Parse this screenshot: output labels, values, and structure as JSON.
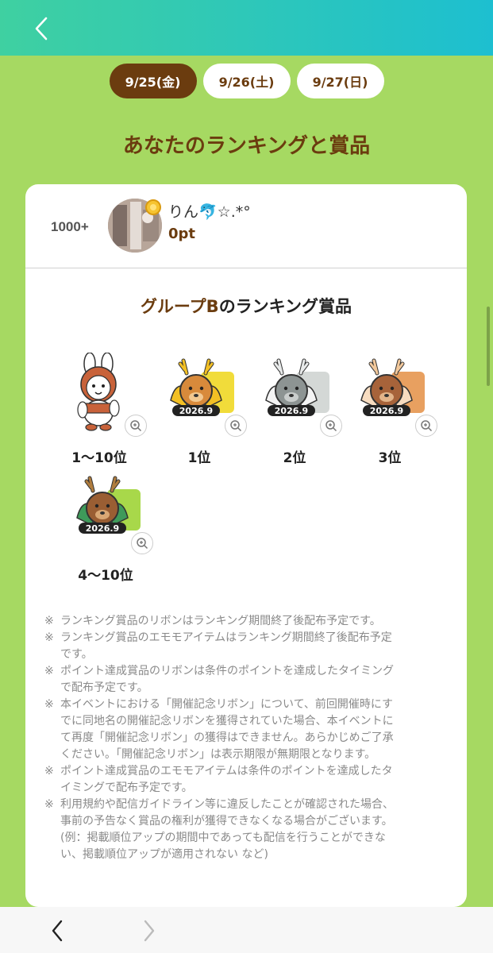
{
  "tabs": [
    {
      "label": "9/25(金)",
      "active": true
    },
    {
      "label": "9/26(土)",
      "active": false
    },
    {
      "label": "9/27(日)",
      "active": false
    }
  ],
  "section_title": "あなたのランキングと賞品",
  "user": {
    "rank": "1000+",
    "name": "りん🐬☆.*°",
    "points": "0pt"
  },
  "group_title_prefix": "グループB",
  "group_title_suffix": "のランキング賞品",
  "prizes": [
    {
      "label": "1〜10位",
      "item": "bunny-costume-character",
      "badge_text": ""
    },
    {
      "label": "1位",
      "item": "gold-reindeer-ribbon",
      "badge_text": "2026.9"
    },
    {
      "label": "2位",
      "item": "silver-reindeer-ribbon",
      "badge_text": "2026.9"
    },
    {
      "label": "3位",
      "item": "bronze-reindeer-ribbon",
      "badge_text": "2026.9"
    },
    {
      "label": "4〜10位",
      "item": "green-reindeer-ribbon",
      "badge_text": "2026.9"
    }
  ],
  "notes_mark": "※",
  "notes": [
    [
      "ランキング賞品のリボンはランキング期間終了後配布予定です。"
    ],
    [
      "ランキング賞品のエモモアイテムはランキング期間終了後配布予定",
      "です。"
    ],
    [
      "ポイント達成賞品のリボンは条件のポイントを達成したタイミング",
      "で配布予定です。"
    ],
    [
      "本イベントにおける「開催記念リボン」について、前回開催時にす",
      "でに同地名の開催記念リボンを獲得されていた場合、本イベントに",
      "て再度「開催記念リボン」の獲得はできません。あらかじめご了承",
      "ください。「開催記念リボン」は表示期限が無期限となります。"
    ],
    [
      "ポイント達成賞品のエモモアイテムは条件のポイントを達成したタ",
      "イミングで配布予定です。"
    ],
    [
      "利用規約や配信ガイドライン等に違反したことが確認された場合、",
      "事前の予告なく賞品の権利が獲得できなくなる場合がございます。",
      "(例：掲載順位アップの期間中であっても配信を行うことができな",
      "い、掲載順位アップが適用されない など)"
    ]
  ],
  "colors": {
    "background": "#a6d962",
    "header_start": "#3fd0a1",
    "header_end": "#1dbfd0",
    "brown": "#6b3c0f"
  }
}
